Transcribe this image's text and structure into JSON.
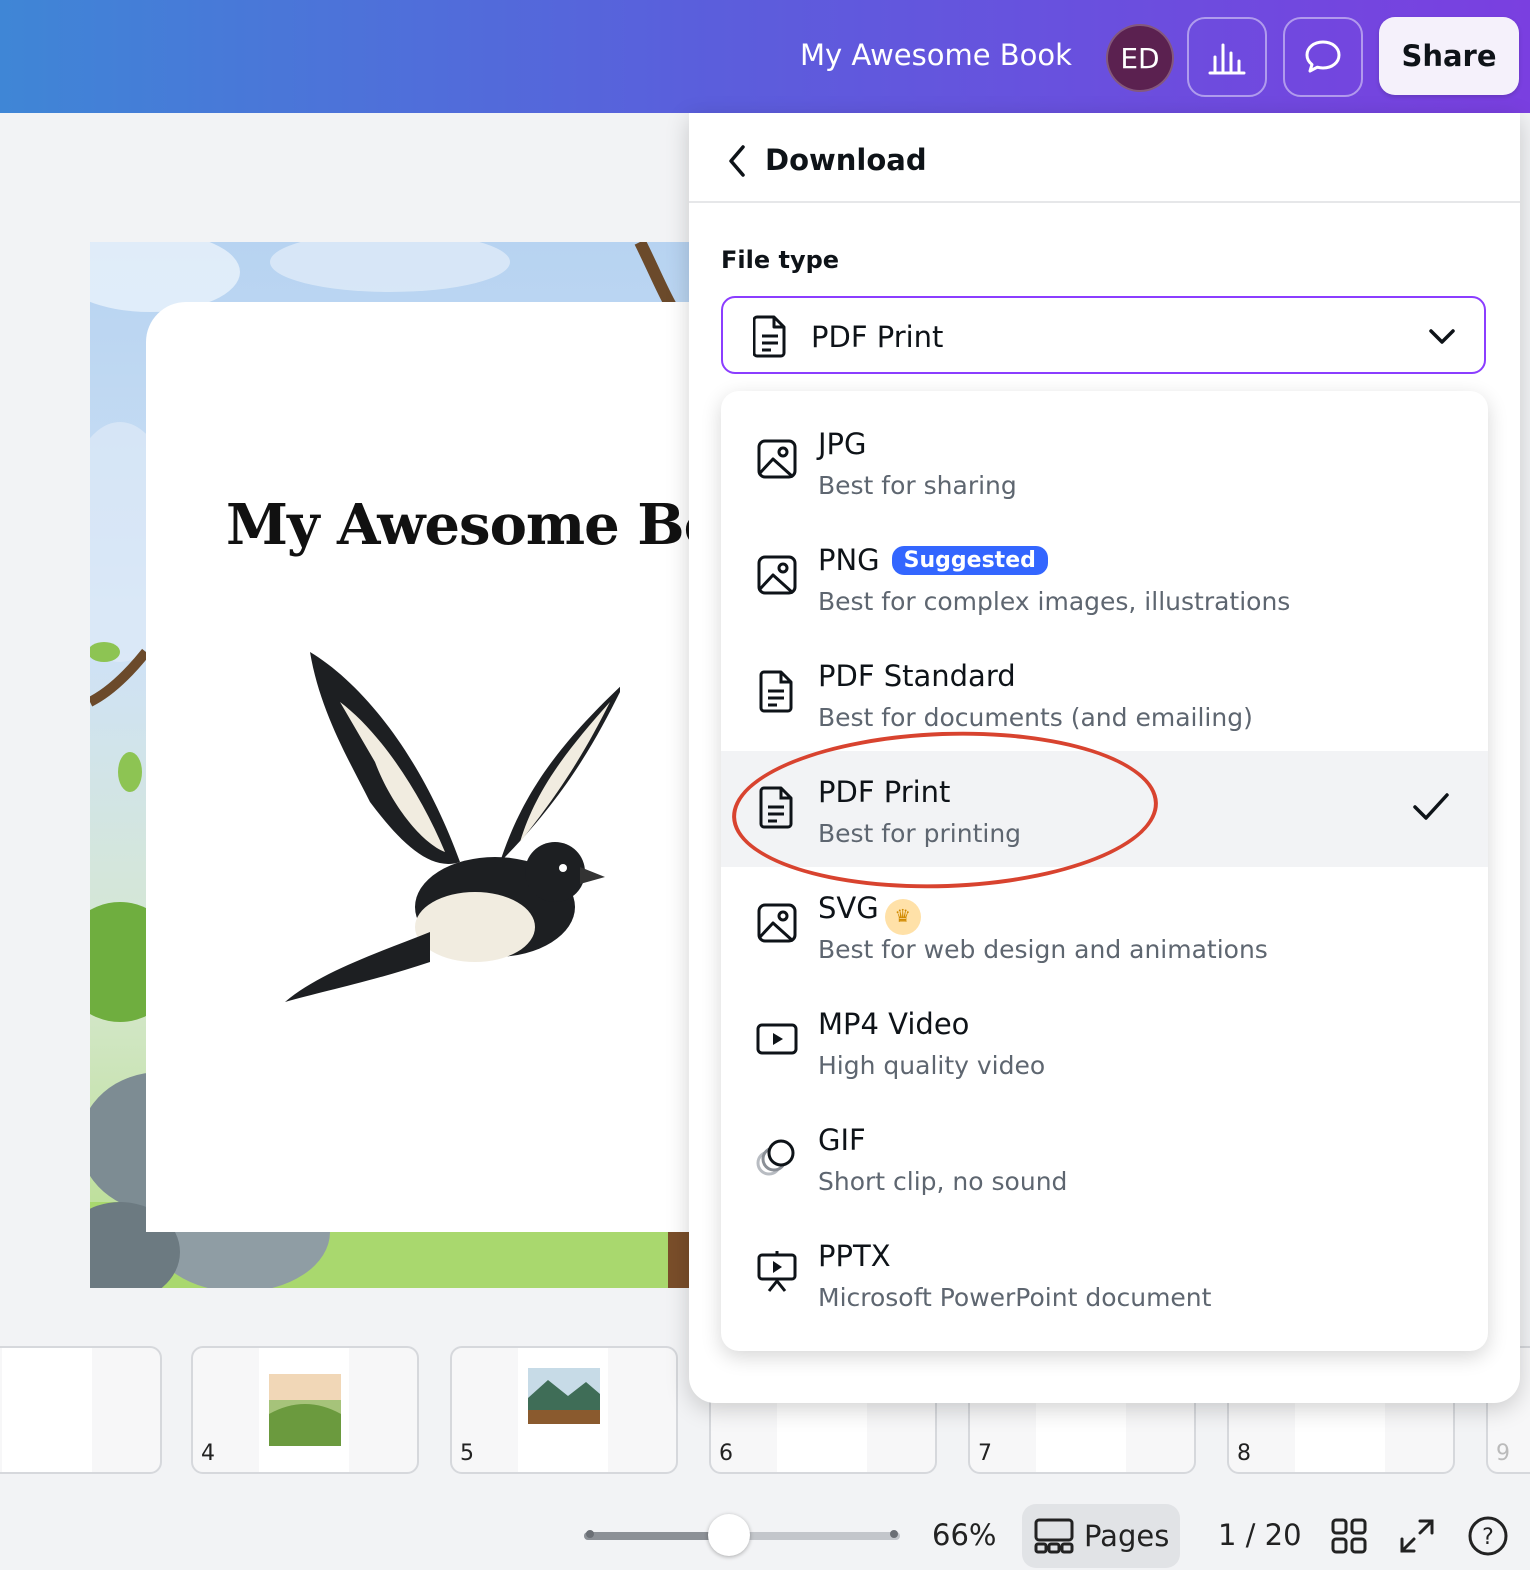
{
  "header": {
    "doc_title": "My Awesome Book",
    "avatar_initials": "ED",
    "share_label": "Share",
    "gradient": [
      "#3f86d6",
      "#7a3fe0"
    ]
  },
  "canvas": {
    "book_title": "My Awesome Book"
  },
  "thumbnails": [
    {
      "num": "4"
    },
    {
      "num": "5"
    },
    {
      "num": "6"
    },
    {
      "num": "7"
    },
    {
      "num": "8"
    },
    {
      "num": "9"
    }
  ],
  "footer": {
    "zoom": "66%",
    "zoom_level_fraction": 0.46,
    "pages_label": "Pages",
    "page_indicator": "1 / 20"
  },
  "download_panel": {
    "title": "Download",
    "file_type_label": "File type",
    "selected_value": "PDF Print",
    "options": [
      {
        "name": "JPG",
        "desc": "Best for sharing",
        "icon": "image-icon"
      },
      {
        "name": "PNG",
        "badge": "Suggested",
        "desc": "Best for complex images, illustrations",
        "icon": "image-icon"
      },
      {
        "name": "PDF Standard",
        "desc": "Best for documents (and emailing)",
        "icon": "document-icon"
      },
      {
        "name": "PDF Print",
        "desc": "Best for printing",
        "icon": "document-icon",
        "selected": true
      },
      {
        "name": "SVG",
        "desc": "Best for web design and animations",
        "icon": "image-icon",
        "premium": true
      },
      {
        "name": "MP4 Video",
        "desc": "High quality video",
        "icon": "video-icon"
      },
      {
        "name": "GIF",
        "desc": "Short clip, no sound",
        "icon": "gif-icon"
      },
      {
        "name": "PPTX",
        "desc": "Microsoft PowerPoint document",
        "icon": "presentation-icon"
      }
    ],
    "accent_color": "#8b3dff",
    "badge_color": "#3366ff",
    "annotation_color": "#d8432f"
  }
}
